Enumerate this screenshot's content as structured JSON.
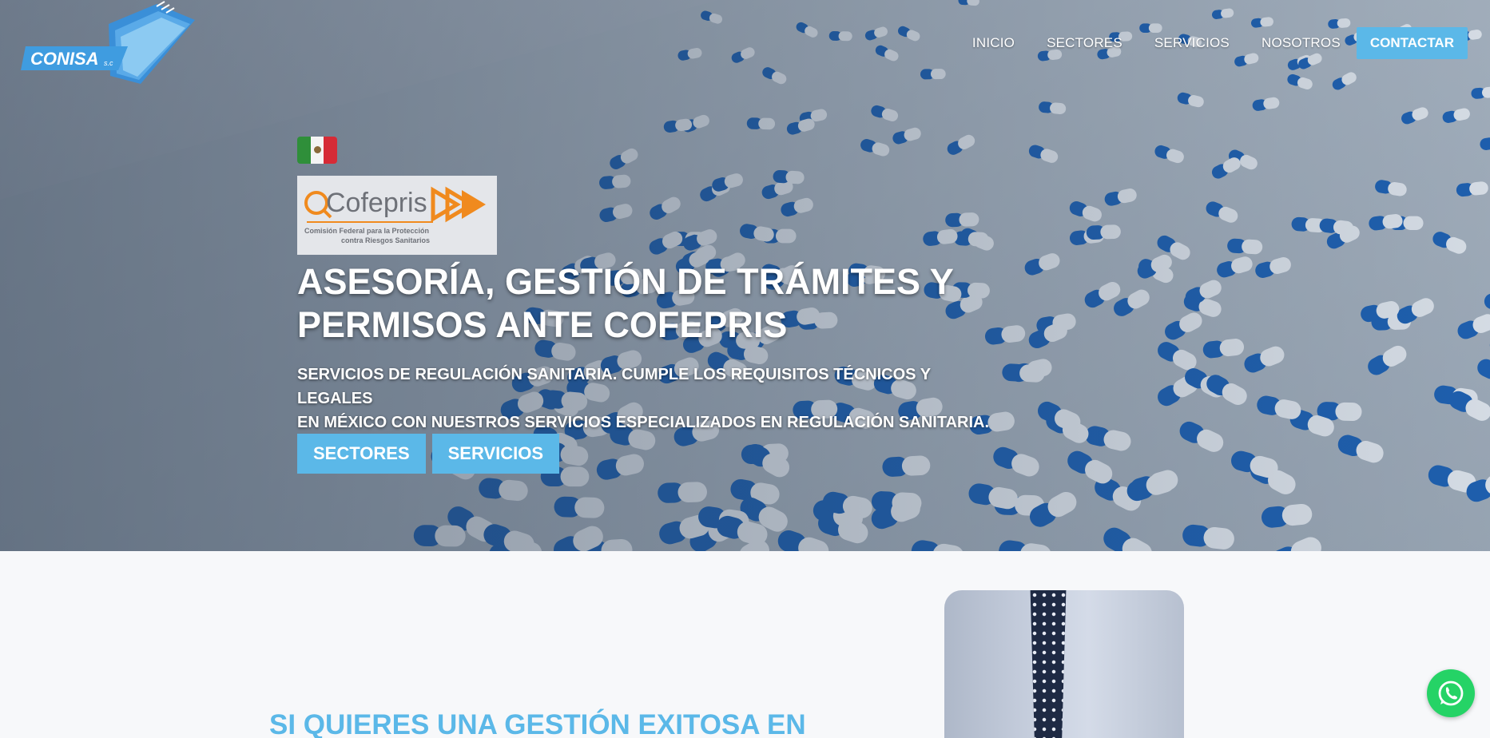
{
  "header": {
    "logo_text": "CONISA",
    "logo_suffix": "s.c",
    "nav": [
      {
        "label": "INICIO"
      },
      {
        "label": "SECTORES"
      },
      {
        "label": "SERVICIOS"
      },
      {
        "label": "NOSOTROS"
      }
    ],
    "cta_label": "CONTACTAR"
  },
  "hero": {
    "cofepris_logo": {
      "name": "Cofepris",
      "line1": "Comisión Federal para la Protección",
      "line2": "contra Riesgos Sanitarios"
    },
    "title_line1": "ASESORÍA, GESTIÓN DE TRÁMITES Y",
    "title_line2": "PERMISOS ANTE COFEPRIS",
    "subtitle_line1": "SERVICIOS DE REGULACIÓN SANITARIA. CUMPLE LOS REQUISITOS TÉCNICOS Y LEGALES",
    "subtitle_line2": "EN MÉXICO CON NUESTROS SERVICIOS ESPECIALIZADOS EN REGULACIÓN SANITARIA.",
    "buttons": [
      {
        "label": "SECTORES"
      },
      {
        "label": "SERVICIOS"
      }
    ]
  },
  "section": {
    "title": "SI QUIERES UNA GESTIÓN EXITOSA EN"
  },
  "colors": {
    "accent": "#5bb8e8",
    "whatsapp": "#25d366",
    "logo_blue": "#2f7fd0"
  },
  "icons": {
    "flag": "mexico-flag-icon",
    "chat": "whatsapp-icon"
  }
}
